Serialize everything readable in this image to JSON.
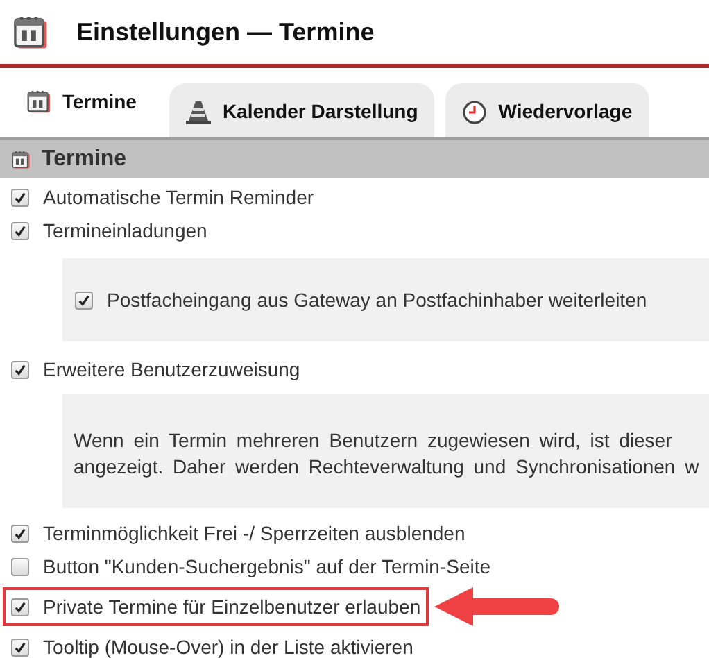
{
  "window": {
    "title": "Einstellungen — Termine"
  },
  "tabs": [
    {
      "label": "Termine",
      "kind": "calendar",
      "selected": true
    },
    {
      "label": "Kalender Darstellung",
      "kind": "cone",
      "selected": false
    },
    {
      "label": "Wiedervorlage",
      "kind": "clock",
      "selected": false
    }
  ],
  "section": {
    "title": "Termine"
  },
  "items": [
    {
      "kind": "checkbox",
      "label": "Automatische Termin Reminder",
      "checked": true,
      "highlighted": false
    },
    {
      "kind": "checkbox",
      "label": "Termineinladungen",
      "checked": true,
      "highlighted": false
    },
    {
      "kind": "group",
      "children": [
        {
          "kind": "checkbox",
          "label": "Postfacheingang aus Gateway an Postfachinhaber weiterleiten",
          "checked": true,
          "highlighted": false
        }
      ]
    },
    {
      "kind": "checkbox",
      "label": "Erweitere Benutzerzuweisung",
      "checked": true,
      "highlighted": false
    },
    {
      "kind": "note",
      "lines": [
        "Wenn ein Termin mehreren Benutzern zugewiesen wird, ist dieser",
        "angezeigt. Daher werden Rechteverwaltung und Synchronisationen w"
      ]
    },
    {
      "kind": "checkbox",
      "label": "Terminmöglichkeit Frei -/ Sperrzeiten ausblenden",
      "checked": true,
      "highlighted": false
    },
    {
      "kind": "checkbox",
      "label": "Button \"Kunden-Suchergebnis\" auf der Termin-Seite",
      "checked": false,
      "highlighted": false
    },
    {
      "kind": "checkbox",
      "label": "Private Termine für Einzelbenutzer erlauben",
      "checked": true,
      "highlighted": true
    },
    {
      "kind": "checkbox",
      "label": "Tooltip (Mouse-Over) in der Liste aktivieren",
      "checked": true,
      "highlighted": false
    }
  ]
}
